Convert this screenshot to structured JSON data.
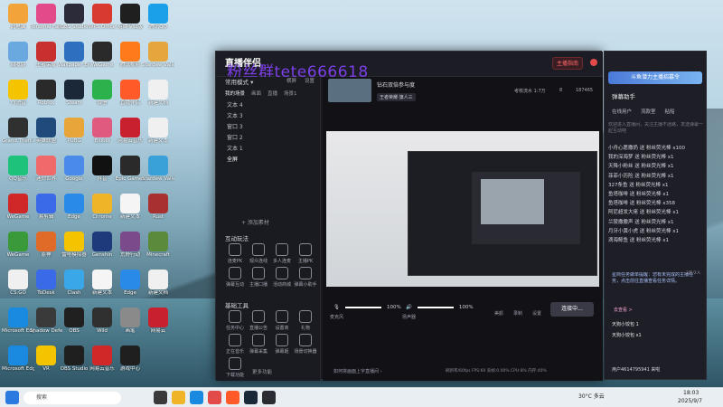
{
  "desktop": {
    "icons": [
      {
        "label": "此电脑",
        "color": "#f2a33a"
      },
      {
        "label": "Personal Fancy",
        "color": "#e34a8a"
      },
      {
        "label": "OBS Studio",
        "color": "#2b2b3a"
      },
      {
        "label": "WPS Office",
        "color": "#d83a30"
      },
      {
        "label": "剪映专业版",
        "color": "#1f1f1f"
      },
      {
        "label": "腾讯QQ",
        "color": "#1aa0e8"
      },
      {
        "label": "回收站",
        "color": "#6aa8e0"
      },
      {
        "label": "王者荣耀",
        "color": "#c83030"
      },
      {
        "label": "Wallpaper Engine",
        "color": "#2f6fbf"
      },
      {
        "label": "WeGame",
        "color": "#2a2a2a"
      },
      {
        "label": "腾讯视频",
        "color": "#ff7a1a"
      },
      {
        "label": "Stardew Valley",
        "color": "#e6a63e"
      },
      {
        "label": "YY语音",
        "color": "#f5c400"
      },
      {
        "label": "Roblox",
        "color": "#2a2a2a"
      },
      {
        "label": "Steam",
        "color": "#1b2838"
      },
      {
        "label": "微信",
        "color": "#2bb24c"
      },
      {
        "label": "直播伴侣",
        "color": "#ff5a28"
      },
      {
        "label": "新建文档",
        "color": "#f0f0f0"
      },
      {
        "label": "Grand Theft Auto V",
        "color": "#303030"
      },
      {
        "label": "英雄联盟",
        "color": "#1f4a7a"
      },
      {
        "label": "PUBG",
        "color": "#e8a53a"
      },
      {
        "label": "Bilibili",
        "color": "#e05a80"
      },
      {
        "label": "网易云音乐",
        "color": "#c8202e"
      },
      {
        "label": "新建文本",
        "color": "#f0f0f0"
      },
      {
        "label": "QQ音乐",
        "color": "#1fc27a"
      },
      {
        "label": "迷你世界",
        "color": "#f06a6a"
      },
      {
        "label": "Google",
        "color": "#4a8ae8"
      },
      {
        "label": "抖音",
        "color": "#111111"
      },
      {
        "label": "Epic Games",
        "color": "#2a2a2a"
      },
      {
        "label": "Stardew Valley",
        "color": "#3aa0d8"
      },
      {
        "label": "WeGame",
        "color": "#d02828"
      },
      {
        "label": "易剪辑",
        "color": "#3a6ae8"
      },
      {
        "label": "Edge",
        "color": "#2a8ae8"
      },
      {
        "label": "Chrome",
        "color": "#f0b429"
      },
      {
        "label": "新建文本",
        "color": "#f5f5f5"
      },
      {
        "label": "Rust",
        "color": "#a83030"
      },
      {
        "label": "WeGame",
        "color": "#3a9a3a"
      },
      {
        "label": "原神",
        "color": "#e06a28"
      },
      {
        "label": "雷电模拟器",
        "color": "#f5c400"
      },
      {
        "label": "Genshin",
        "color": "#1f3a7a"
      },
      {
        "label": "荒野行动",
        "color": "#7a4a8a"
      },
      {
        "label": "Minecraft",
        "color": "#5a8a3a"
      },
      {
        "label": "CS:GO",
        "color": "#f0f0f0"
      },
      {
        "label": "ToDesk",
        "color": "#3a6ae8"
      },
      {
        "label": "Clash",
        "color": "#3aa8e8"
      },
      {
        "label": "新建文本",
        "color": "#f5f5f5"
      },
      {
        "label": "Edge",
        "color": "#2a8ae8"
      },
      {
        "label": "新建文档",
        "color": "#f0f0f0"
      },
      {
        "label": "Microsoft Edge",
        "color": "#1a8ae0"
      },
      {
        "label": "Shadow Defender",
        "color": "#3a3a3a"
      },
      {
        "label": "OBS",
        "color": "#202020"
      },
      {
        "label": "Wild",
        "color": "#303030"
      },
      {
        "label": "画笔",
        "color": "#8a8a8a"
      },
      {
        "label": "网易云",
        "color": "#c8202e"
      },
      {
        "label": "Microsoft Edge",
        "color": "#1a8ae0"
      },
      {
        "label": "VR",
        "color": "#f5c400"
      },
      {
        "label": "OBS Studio",
        "color": "#1f1f1f"
      },
      {
        "label": "网易云音乐",
        "color": "#d02828"
      },
      {
        "label": "游戏中心",
        "color": "#1f1f1f"
      },
      {
        "label": "",
        "color": "transparent"
      }
    ]
  },
  "app": {
    "logo": "直播伴侣",
    "watermark": "粉丝群tete666618",
    "mode": "常用模式 ▾",
    "btn_fold": "横屏",
    "btn_settings": "设置",
    "scene_label": "钻石双倍参与度",
    "tag": "王者荣耀·旗人三",
    "live_btn": "主播指南",
    "clock": "考核流水 1:7万",
    "count1": "8",
    "count2": "187465",
    "tabs": [
      "我的场景",
      "画面",
      "直播",
      "场景1"
    ],
    "scenes": [
      "文本 4",
      "文本 3",
      "窗口 3",
      "窗口 2",
      "文本 1",
      "全屏"
    ],
    "add_source": "+ 添加素材",
    "interact_title": "互动玩法",
    "interact_tools": [
      "连麦PK",
      "观众连线",
      "多人连麦",
      "主播PK",
      "弹幕互动",
      "主播口播",
      "活动商城",
      "弹幕小助手"
    ],
    "basic_title": "基础工具",
    "basic_tools": [
      "任务中心",
      "直播公告",
      "设置商",
      "礼物",
      "正在音乐",
      "弹幕采集",
      "弹幕姬",
      "场景切换器",
      "下载功能"
    ],
    "more_tools": "更多功能",
    "mic_label": "麦克风",
    "mic_value": "100%",
    "speaker_label": "扬声器",
    "speaker_value": "100%",
    "bottom_tools": [
      "美颜",
      "录制",
      "设置"
    ],
    "start_btn": "连接中...",
    "status_left": "如何将画面上字直播间 ›",
    "status_fps": "刷新率/60fps  FPS:60  丢帧:0.00%  CPU:8%  内存:40%"
  },
  "chat": {
    "banner": "斗鱼潜力主播招募令",
    "title": "弹幕助手",
    "tabs": [
      "在线用户",
      "流款室",
      "粘船"
    ],
    "notice": "欢迎进入直播间，关注主播不迷路，发送弹幕一起互动吧",
    "messages": [
      "小舟心愿撒奶 送 粉丝荧光棒 x100",
      "我的深海梦 送 粉丝荧光棒 x1",
      "天降小粉丝 送 粉丝荧光棒 x1",
      "菲菲小历险 送 粉丝荧光棒 x1",
      "327条鱼 送 粉丝荧光棒 x1",
      "鱼塔咖啡 送 粉丝荧光棒 x1",
      "鱼塔咖啡 送 粉丝荧光棒 x358",
      "阿尼超发大佬 送 粉丝荧光棒 x1",
      "兰陵撒撒声 送 粉丝荧光棒 x1",
      "月牙小黄小虎 送 粉丝荧光棒 x1",
      "滴海鲸鱼 送 粉丝荧光棒 x1"
    ],
    "task_box": "星商任务做单提醒：您有未完成的主播任务，点击前往直播查看任务详情。",
    "task_page": "2页/2人",
    "task_link": "去查看 >",
    "gift_lines": [
      "天狗小饺包 1",
      "天狗小饺包 x1"
    ],
    "bottom_user": "用户4614795941 来啦"
  },
  "taskbar": {
    "search": "搜索",
    "weather": "30°C 多云",
    "time": "18:03",
    "date": "2025/9/7"
  }
}
